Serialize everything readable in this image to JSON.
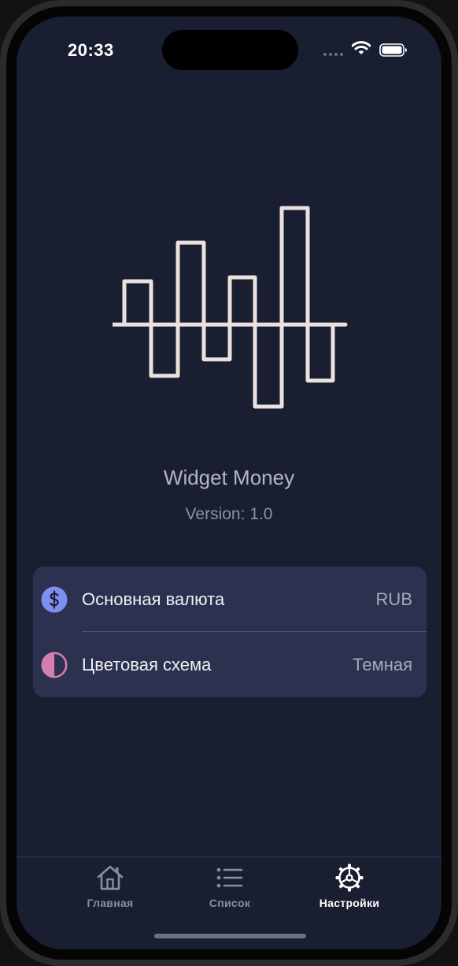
{
  "status_bar": {
    "time": "20:33"
  },
  "about": {
    "app_name": "Widget Money",
    "version": "Version: 1.0",
    "logo_icon": "bar-wave-logo-icon"
  },
  "settings": {
    "items": [
      {
        "label": "Основная валюта",
        "value": "RUB",
        "icon": "dollar-icon",
        "icon_color": "#7e8ff0"
      },
      {
        "label": "Цветовая схема",
        "value": "Темная",
        "icon": "half-circle-contrast-icon",
        "icon_color": "#d27fb0"
      }
    ]
  },
  "tabbar": {
    "tabs": [
      {
        "label": "Главная",
        "icon": "house-icon",
        "active": false
      },
      {
        "label": "Список",
        "icon": "list-icon",
        "active": false
      },
      {
        "label": "Настройки",
        "icon": "gear-icon",
        "active": true
      }
    ]
  },
  "colors": {
    "background": "#1a1e31",
    "card": "#2d3150",
    "logo_stroke": "#ebe1df",
    "tab_active": "#ffffff",
    "tab_inactive": "#8b8e9c"
  }
}
